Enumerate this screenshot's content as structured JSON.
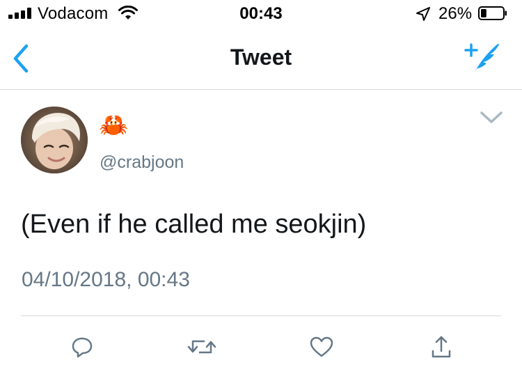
{
  "status_bar": {
    "carrier": "Vodacom",
    "time": "00:43",
    "battery_percent": "26%",
    "battery_level": 0.26,
    "signal_bars": 4
  },
  "nav": {
    "title": "Tweet",
    "back_icon": "chevron-left-icon",
    "compose_icon": "compose-tweet-icon"
  },
  "tweet": {
    "display_name": "🦀",
    "handle": "@crabjoon",
    "text": "(Even if he called me seokjin)",
    "timestamp": "04/10/2018, 00:43"
  },
  "actions": [
    {
      "name": "reply",
      "icon": "reply-icon"
    },
    {
      "name": "retweet",
      "icon": "retweet-icon"
    },
    {
      "name": "like",
      "icon": "heart-icon"
    },
    {
      "name": "share",
      "icon": "share-icon"
    }
  ],
  "colors": {
    "accent": "#1da1f2",
    "secondary_text": "#657786",
    "divider": "#d3d6d9",
    "action_icon": "#657786"
  }
}
